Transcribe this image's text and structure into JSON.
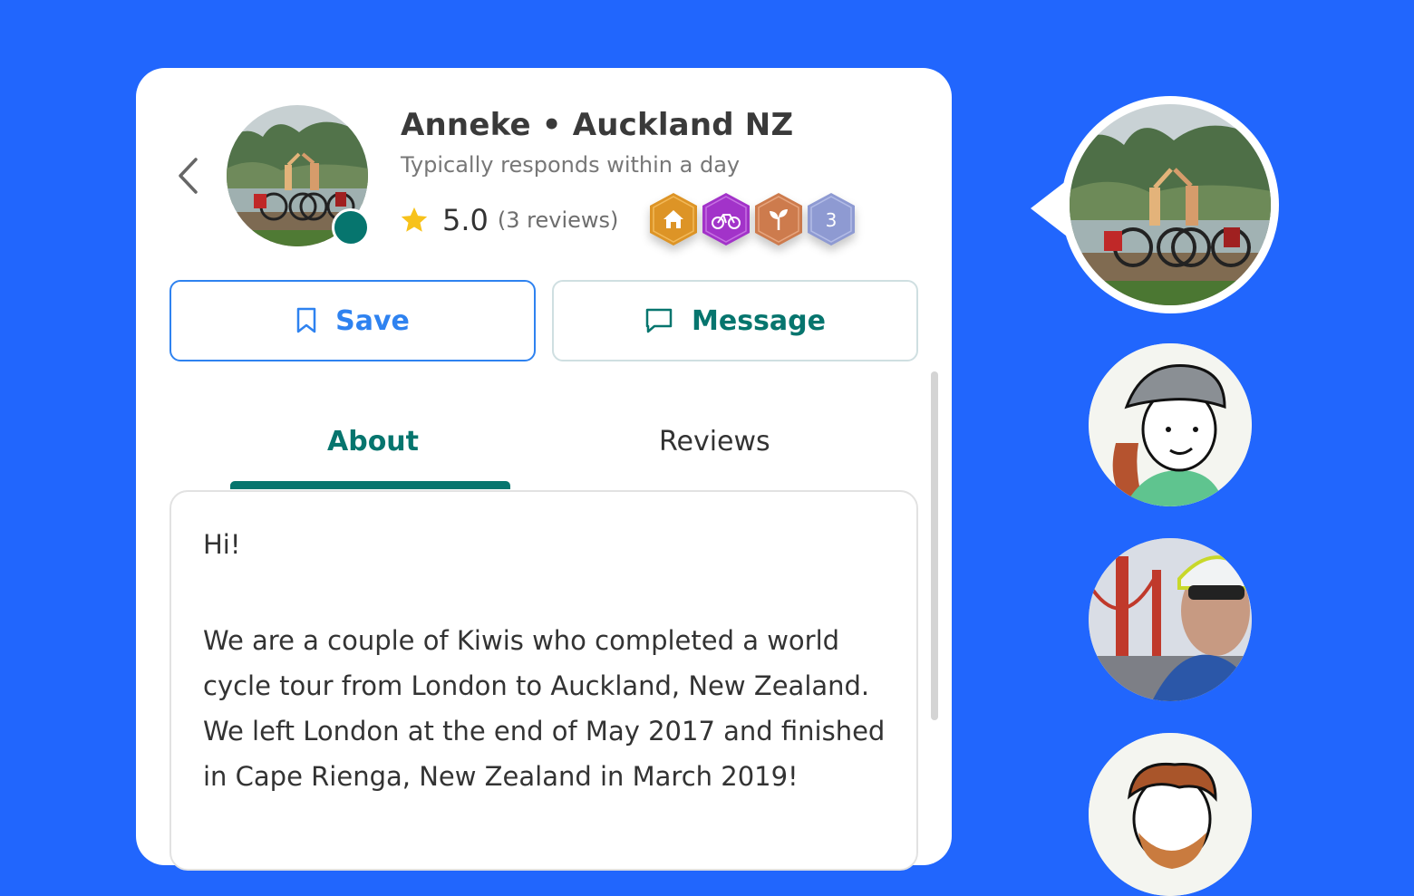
{
  "profile": {
    "name": "Anneke • Auckland NZ",
    "response_time": "Typically responds within a day",
    "rating": "5.0",
    "review_count": "(3 reviews)",
    "online": true,
    "online_color": "#06756e"
  },
  "badges": [
    {
      "icon": "house-icon",
      "color": "#dd9426"
    },
    {
      "icon": "bicycle-icon",
      "color": "#a233c9"
    },
    {
      "icon": "sprout-icon",
      "color": "#cd7b4d"
    },
    {
      "icon": "number-badge",
      "label": "3",
      "color": "#8e9ad2"
    }
  ],
  "actions": {
    "save_label": "Save",
    "message_label": "Message"
  },
  "tabs": [
    {
      "label": "About",
      "active": true
    },
    {
      "label": "Reviews",
      "active": false
    }
  ],
  "about": {
    "greeting": "Hi!",
    "body": "We are a couple of Kiwis who completed a world cycle tour from London to Auckland, New Zealand. We left London at the end of May 2017 and finished in Cape Rienga, New Zealand in March 2019!"
  },
  "colors": {
    "background": "#2166fd",
    "accent_teal": "#06756e",
    "accent_blue": "#2e82f0",
    "star": "#f7c21b"
  }
}
